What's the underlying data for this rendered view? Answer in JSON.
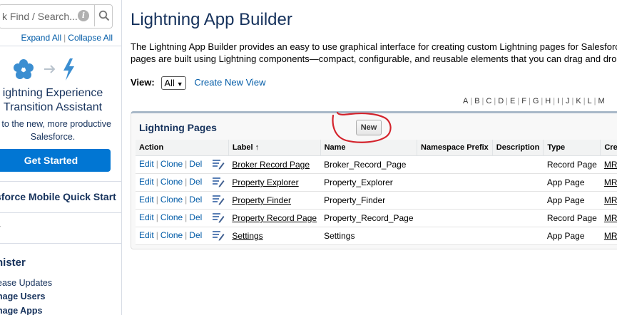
{
  "sidebar": {
    "search_placeholder": "k Find / Search...",
    "expand_all": "Expand All",
    "collapse_all": "Collapse All",
    "assistant_title_line1": "ightning Experience",
    "assistant_title_line2": "Transition Assistant",
    "assistant_sub_line1": "e to the new, more productive",
    "assistant_sub_line2": "Salesforce.",
    "get_started": "Get Started",
    "mobile_quick_start": "sforce Mobile Quick Start",
    "administer": "nister",
    "links": [
      "ease Updates",
      "nage Users",
      "nage Apps"
    ],
    "colors": {
      "brand": "#0176d3",
      "link": "#015ba7",
      "text": "#16325c"
    }
  },
  "main": {
    "title": "Lightning App Builder",
    "description_line1": "The Lightning App Builder provides an easy to use graphical interface for creating custom Lightning pages for Salesforce",
    "description_line2": "pages are built using Lightning components—compact, configurable, and reusable elements that you can drag and drop",
    "view_label": "View:",
    "view_value": "All",
    "create_new_view": "Create New View",
    "alphabet": [
      "A",
      "B",
      "C",
      "D",
      "E",
      "F",
      "G",
      "H",
      "I",
      "J",
      "K",
      "L",
      "M"
    ],
    "card_title": "Lightning Pages",
    "new_button": "New",
    "table": {
      "headers": [
        "Action",
        "Label",
        "Name",
        "Namespace Prefix",
        "Description",
        "Type",
        "Creat"
      ],
      "sort_indicator": "↑",
      "action_labels": {
        "edit": "Edit",
        "clone": "Clone",
        "del": "Del"
      },
      "rows": [
        {
          "label": "Broker Record Page",
          "name": "Broker_Record_Page",
          "namespace": "",
          "description": "",
          "type": "Record Page",
          "created": "MRan"
        },
        {
          "label": "Property Explorer",
          "name": "Property_Explorer",
          "namespace": "",
          "description": "",
          "type": "App Page",
          "created": "MRan"
        },
        {
          "label": "Property Finder",
          "name": "Property_Finder",
          "namespace": "",
          "description": "",
          "type": "App Page",
          "created": "MRan"
        },
        {
          "label": "Property Record Page",
          "name": "Property_Record_Page",
          "namespace": "",
          "description": "",
          "type": "Record Page",
          "created": "MRan"
        },
        {
          "label": "Settings",
          "name": "Settings",
          "namespace": "",
          "description": "",
          "type": "App Page",
          "created": "MRan"
        }
      ]
    },
    "annotation_color": "#d4242d"
  }
}
